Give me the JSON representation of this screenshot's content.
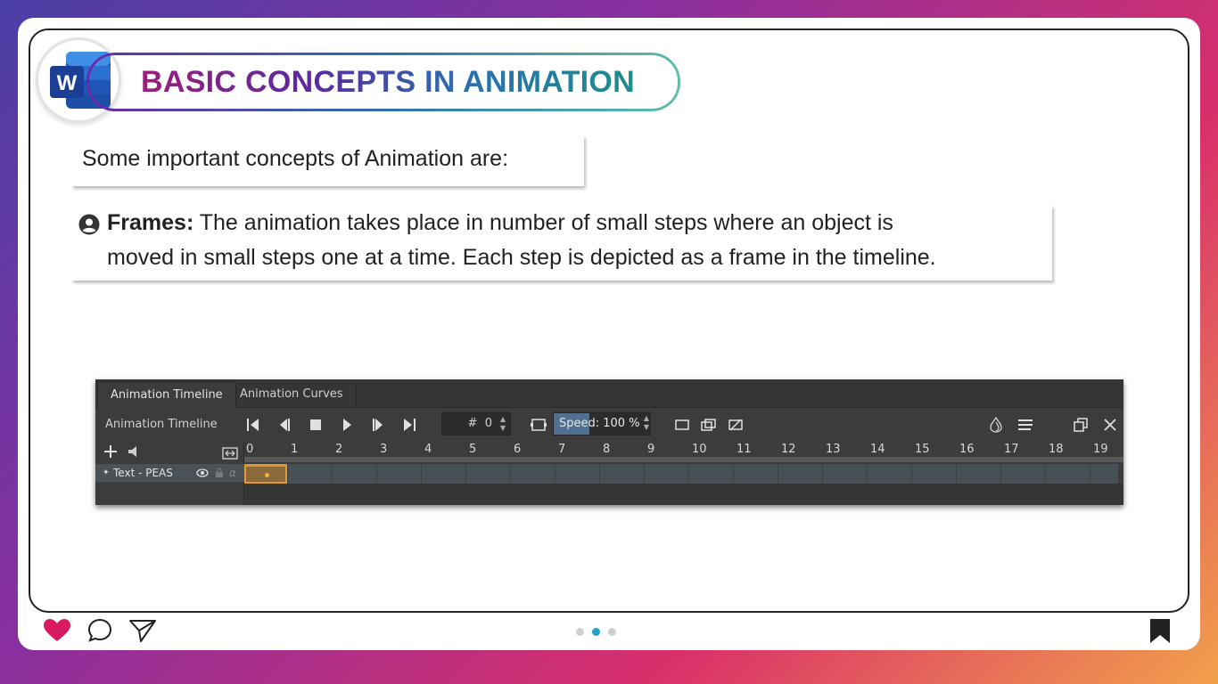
{
  "slide": {
    "title": "BASIC CONCEPTS IN ANIMATION",
    "intro": "Some important concepts of Animation are:",
    "frames_term": "Frames:",
    "frames_line1": " The animation takes place in number of small steps where an object is",
    "frames_line2": "moved in small steps one at a time. Each step is depicted as a frame in the timeline.",
    "logo_letter": "W"
  },
  "timeline": {
    "tabs": [
      "Animation Timeline",
      "Animation Curves"
    ],
    "active_tab": "Animation Timeline",
    "toolbar_label": "Animation Timeline",
    "frame_prefix": "#",
    "frame_value": "0",
    "speed_label": "Speed: 100 %",
    "speed_value_percent": 100,
    "layer_name": "Text - PEAS",
    "alpha_symbol": "α",
    "ruler": [
      "0",
      "1",
      "2",
      "3",
      "4",
      "5",
      "6",
      "7",
      "8",
      "9",
      "10",
      "11",
      "12",
      "13",
      "14",
      "15",
      "16",
      "17",
      "18",
      "19"
    ],
    "current_frame": 0,
    "colors": {
      "panel": "#3c3c3c",
      "current_frame": "#e09a30",
      "speed_fill": "#4f7090"
    }
  },
  "footer": {
    "icons": [
      "heart-icon",
      "comment-icon",
      "send-icon",
      "bookmark-icon"
    ],
    "page_dots": 3,
    "active_dot": 1,
    "colors": {
      "heart": "#d81b60",
      "active_dot": "#1fa6c8"
    }
  }
}
